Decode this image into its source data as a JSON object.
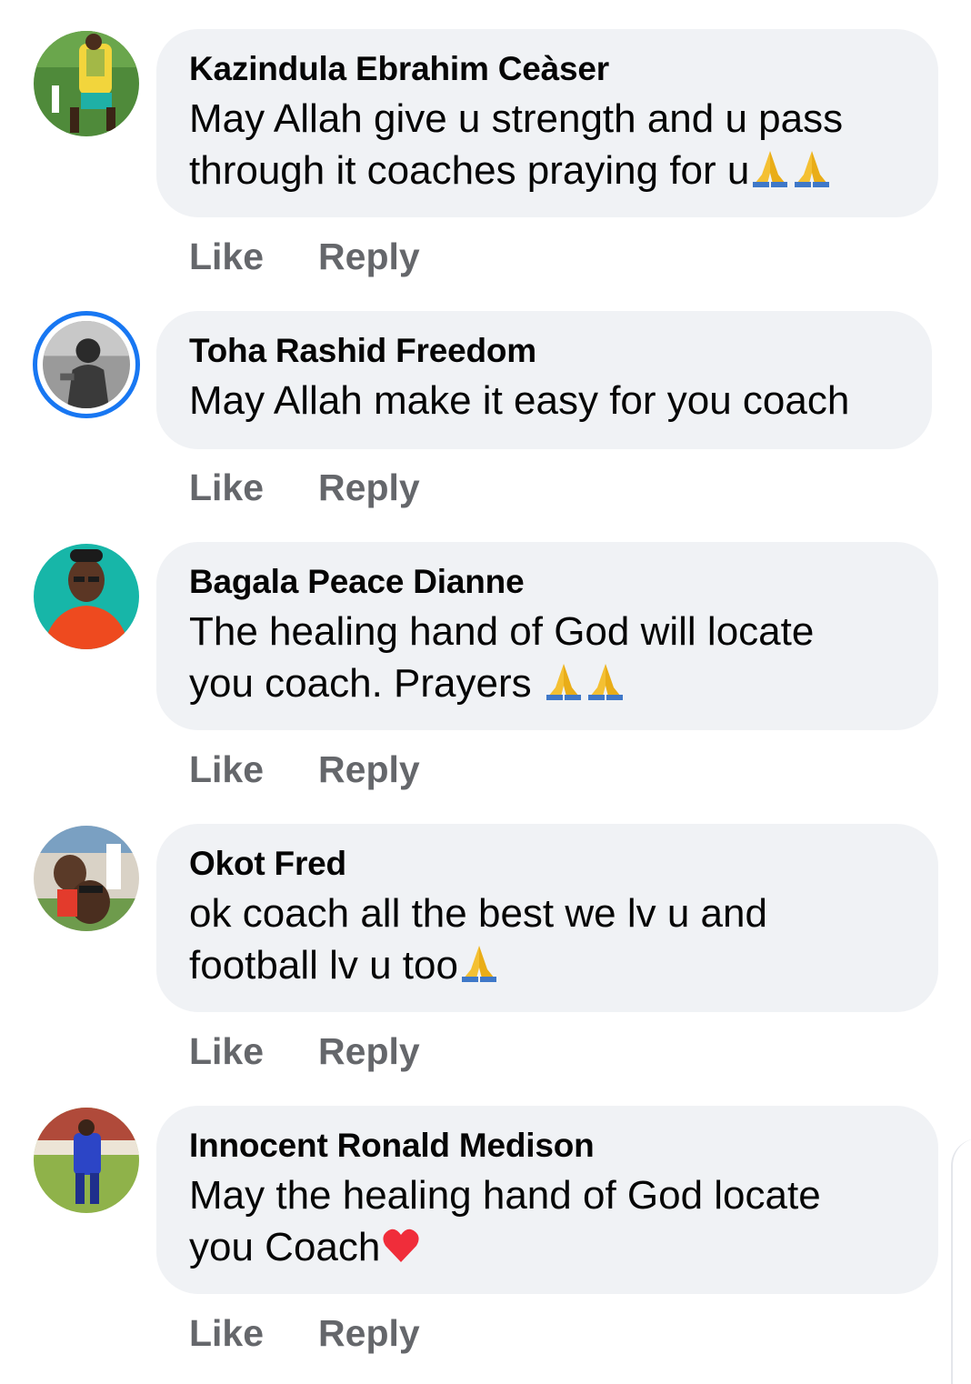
{
  "comments": [
    {
      "author": "Kazindula Ebrahim Ceàser",
      "lines": [
        "May Allah give u strength and u pass",
        "through it coaches praying for u"
      ],
      "emoji": "folded-hands-emoji folded-hands-emoji",
      "like": "Like",
      "reply": "Reply"
    },
    {
      "author": "Toha Rashid Freedom",
      "lines": [
        "May Allah make it easy for you coach"
      ],
      "like": "Like",
      "reply": "Reply"
    },
    {
      "author": "Bagala Peace Dianne",
      "lines": [
        "The healing hand of God will locate",
        "you coach. Prayers "
      ],
      "emoji": "folded-hands-emoji folded-hands-emoji",
      "like": "Like",
      "reply": "Reply"
    },
    {
      "author": "Okot Fred",
      "lines": [
        "ok coach all the best we lv u and",
        "football lv u too"
      ],
      "emoji": "folded-hands-emoji",
      "like": "Like",
      "reply": "Reply"
    },
    {
      "author": "Innocent Ronald Medison",
      "lines": [
        "May the healing hand of God locate",
        "you Coach"
      ],
      "emoji": "red-heart-emoji",
      "like": "Like",
      "reply": "Reply"
    }
  ],
  "colors": {
    "bubble": "#f0f2f5",
    "action_text": "#65676b",
    "story_ring": "#1877f2",
    "text": "#050505"
  }
}
